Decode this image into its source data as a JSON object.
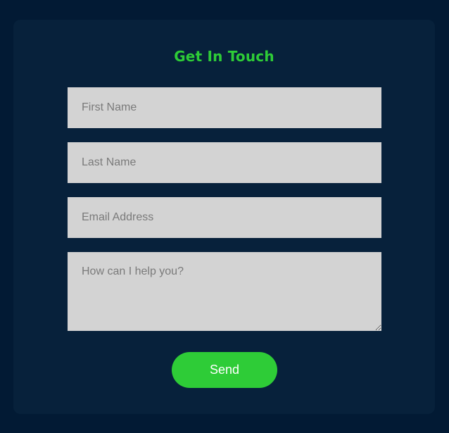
{
  "form": {
    "title": "Get In Touch",
    "first_name_placeholder": "First Name",
    "last_name_placeholder": "Last Name",
    "email_placeholder": "Email Address",
    "message_placeholder": "How can I help you?",
    "send_label": "Send"
  },
  "colors": {
    "page_background": "#021a34",
    "card_background": "#07213b",
    "accent": "#2ecc37",
    "field_background": "#d3d3d3"
  }
}
